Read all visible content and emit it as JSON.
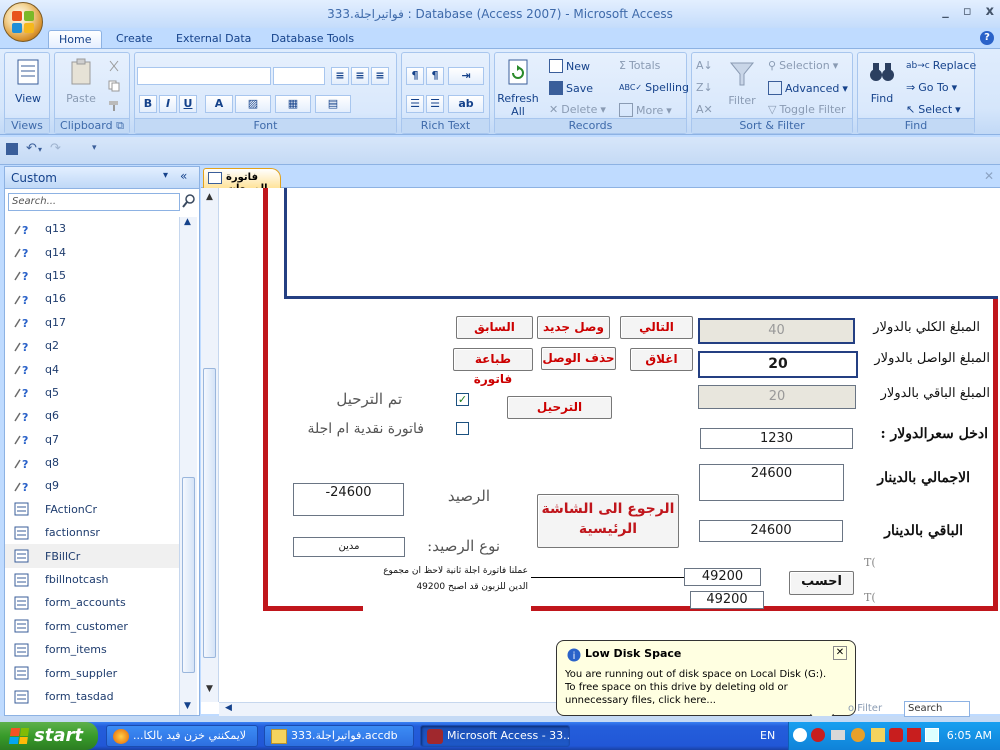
{
  "window": {
    "title": "333.فواتيراجلة : Database (Access 2007) - Microsoft Access",
    "controls": [
      "_",
      "▫",
      "x"
    ]
  },
  "ribbon": {
    "tabs": [
      "Home",
      "Create",
      "External Data",
      "Database Tools"
    ],
    "active_tab": "Home",
    "groups": {
      "views": {
        "label": "Views",
        "view": "View"
      },
      "clipboard": {
        "label": "Clipboard",
        "paste": "Paste"
      },
      "font": {
        "label": "Font"
      },
      "rich_text": {
        "label": "Rich Text"
      },
      "records": {
        "label": "Records",
        "refresh": "Refresh All",
        "new": "New",
        "save": "Save",
        "delete": "Delete",
        "totals": "Totals",
        "spelling": "Spelling",
        "more": "More"
      },
      "sort_filter": {
        "label": "Sort & Filter",
        "filter": "Filter",
        "selection": "Selection",
        "advanced": "Advanced",
        "toggle": "Toggle Filter"
      },
      "find": {
        "label": "Find",
        "find": "Find",
        "replace": "Replace",
        "goto": "Go To",
        "select": "Select"
      }
    }
  },
  "nav": {
    "title": "Custom",
    "search_placeholder": "Search...",
    "items": [
      {
        "name": "q13",
        "type": "query"
      },
      {
        "name": "q14",
        "type": "query"
      },
      {
        "name": "q15",
        "type": "query"
      },
      {
        "name": "q16",
        "type": "query"
      },
      {
        "name": "q17",
        "type": "query"
      },
      {
        "name": "q2",
        "type": "query"
      },
      {
        "name": "q4",
        "type": "query"
      },
      {
        "name": "q5",
        "type": "query"
      },
      {
        "name": "q6",
        "type": "query"
      },
      {
        "name": "q7",
        "type": "query"
      },
      {
        "name": "q8",
        "type": "query"
      },
      {
        "name": "q9",
        "type": "query"
      },
      {
        "name": "FActionCr",
        "type": "form"
      },
      {
        "name": "factionnsr",
        "type": "form"
      },
      {
        "name": "FBillCr",
        "type": "form",
        "selected": true
      },
      {
        "name": "fbillnotcash",
        "type": "form"
      },
      {
        "name": "form_accounts",
        "type": "form"
      },
      {
        "name": "form_customer",
        "type": "form"
      },
      {
        "name": "form_items",
        "type": "form"
      },
      {
        "name": "form_suppler",
        "type": "form"
      },
      {
        "name": "form_tasdad",
        "type": "form"
      }
    ]
  },
  "document": {
    "tab_label": "فاتورة المبيعات",
    "buttons": {
      "prev": "السابق",
      "new_receipt": "وصل جديد",
      "next": "التالي",
      "print_invoice": "طباعة فاتورة",
      "delete_receipt": "حذف الوصل",
      "close": "اغلاق",
      "post": "الترحيل",
      "back_main": "الرجوع الى الشاشة الرئيسية",
      "calculate": "احسب"
    },
    "labels": {
      "total_usd": "المبلغ الكلي بالدولار",
      "paid_usd": "المبلغ الواصل بالدولار",
      "remaining_usd": "المبلغ الباقي بالدولار",
      "exchange_rate": "ادخل سعرالدولار :",
      "total_dinar": "الاجمالي بالدينار",
      "remaining_dinar": "الباقي بالدينار",
      "posted": "تم الترحيل",
      "cash_or_credit": "فاتورة نقدية ام اجلة",
      "balance": "الرصيد",
      "balance_type": "نوع الرصيد:",
      "te1": "T(",
      "te2": "T("
    },
    "values": {
      "total_usd": "40",
      "paid_usd": "20",
      "remaining_usd": "20",
      "exchange_rate": "1230",
      "total_dinar": "24600",
      "remaining_dinar": "24600",
      "balance": "-24600",
      "balance_type": "مدين",
      "sum1": "49200",
      "sum2": "49200",
      "posted_checked": "✓",
      "cash_checked": ""
    },
    "note": "عملنا فاتورة اجلة ثانية لاحظ ان مجموع الدين للزبون قد اصبح 49200"
  },
  "balloon": {
    "title": "Low Disk Space",
    "line1": "You are running out of disk space on Local Disk (G:).",
    "line2": "To free space on this drive by deleting old or unnecessary files, click here..."
  },
  "statusbar": {
    "filter": "o Filter",
    "search": "Search"
  },
  "taskbar": {
    "start": "start",
    "tasks": [
      {
        "label": "...لايمكنني خزن فيد بالكا",
        "active": false
      },
      {
        "label": "333.فواتيراجلة.accdb",
        "active": false
      },
      {
        "label": "Microsoft Access - 33...",
        "active": true
      }
    ],
    "lang": "EN",
    "clock": "6:05 AM"
  },
  "colors": {
    "frame_red": "#c0161c",
    "frame_navy": "#243f82",
    "button_text_red": "#cc0000",
    "ribbon_blue": "#bfdbff"
  }
}
